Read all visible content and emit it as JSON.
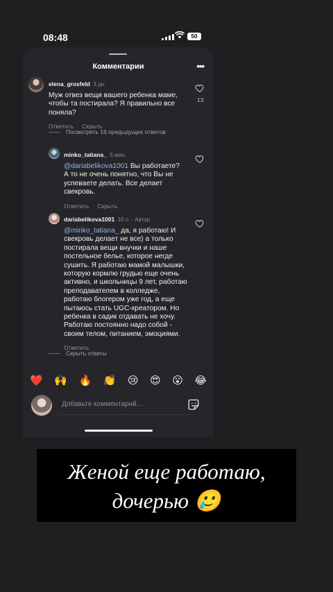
{
  "status": {
    "time": "08:48",
    "battery": "50"
  },
  "sheet": {
    "title": "Комментарии"
  },
  "comments": [
    {
      "user": "elena_grosfeld",
      "meta": "3 дн.",
      "text": "Муж отвез вещи вашего ребенка маме, чтобы та постирала? Я правильно все поняла?",
      "reply_label": "Ответить",
      "hide_label": "Скрыть",
      "likes": "13"
    },
    {
      "user": "minko_tatiana_",
      "meta": "5 мин.",
      "mention": "@dariabelikova1001",
      "text": " Вы работаете? А то не очень понятно, что Вы не успеваете делать. Все делает свекровь.",
      "reply_label": "Ответить",
      "hide_label": "Скрыть"
    },
    {
      "user": "dariabelikova1001",
      "meta": "10 с. · Автор",
      "mention": "@minko_tatiana_",
      "text": " да, я работаю! И свекровь делает не все) а только постирала вещи внучки и наше постельное белье, которое негде сушить. Я работаю мамой малышки, которую кормлю грудью еще очень активно, и школьницы 9 лет, работаю преподавателем в колледже, работаю блогером уже год, а еще пытаюсь стать UGC-креатором. Но ребенка в садик отдавать не хочу. Работаю постоянно надо собой - своим телом, питанием, эмоциями.",
      "reply_label": "Ответить"
    }
  ],
  "view_previous": "Посмотреть 16 предыдущих ответов",
  "hide_replies": "Скрыть ответы",
  "emojis": [
    "❤️",
    "🙌",
    "🔥",
    "👏",
    "😢",
    "😍",
    "😮",
    "😂"
  ],
  "input": {
    "placeholder": "Добавьте комментарий..."
  },
  "caption": {
    "line1": "Женой еще работаю,",
    "line2": "дочерью 🥲"
  },
  "colors": {
    "background": "#1f1f21",
    "sheet": "#26262a",
    "mention": "#94b2e6"
  },
  "icons": [
    "more-icon",
    "heart-icon",
    "sticker-icon",
    "wifi-icon",
    "signal-icon"
  ]
}
